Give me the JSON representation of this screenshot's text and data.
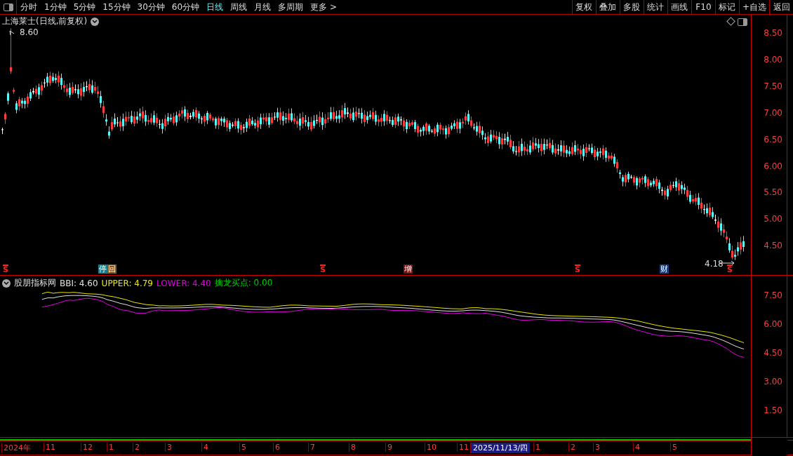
{
  "toolbar": {
    "periods": [
      {
        "label": "分时",
        "selected": false
      },
      {
        "label": "1分钟",
        "selected": false
      },
      {
        "label": "5分钟",
        "selected": false
      },
      {
        "label": "15分钟",
        "selected": false
      },
      {
        "label": "30分钟",
        "selected": false
      },
      {
        "label": "60分钟",
        "selected": false
      },
      {
        "label": "日线",
        "selected": true
      },
      {
        "label": "周线",
        "selected": false
      },
      {
        "label": "月线",
        "selected": false
      },
      {
        "label": "多周期",
        "selected": false
      },
      {
        "label": "更多 >",
        "selected": false
      }
    ],
    "actions": [
      "复权",
      "叠加",
      "多股",
      "统计",
      "画线",
      "F10",
      "标记",
      "+自选",
      "返回"
    ]
  },
  "price_panel": {
    "title": "上海莱士(日线,前复权)",
    "high_label": "8.60",
    "low_label": "4.18",
    "axis_labels": [
      "8.50",
      "8.00",
      "7.50",
      "7.00",
      "6.50",
      "6.00",
      "5.50",
      "5.00",
      "4.50"
    ],
    "markers": [
      {
        "kind": "signal",
        "text": "S"
      },
      {
        "kind": "tag",
        "text": "停",
        "color": "#167c86"
      },
      {
        "kind": "tag",
        "text": "回",
        "color": "#8a5418"
      },
      {
        "kind": "signal",
        "text": "S"
      },
      {
        "kind": "tag",
        "text": "增",
        "color": "#7a1010"
      },
      {
        "kind": "signal",
        "text": "S"
      },
      {
        "kind": "tag",
        "text": "财",
        "color": "#183f86"
      },
      {
        "kind": "signal",
        "text": "S"
      }
    ]
  },
  "indicator_panel": {
    "name": "股朋指标网",
    "readings": [
      {
        "text": "BBI: 4.60",
        "color": "#e0e0e0"
      },
      {
        "text": "UPPER: 4.79",
        "color": "#e8e800"
      },
      {
        "text": "LOWER: 4.40",
        "color": "#e000e0"
      },
      {
        "text": "擒龙买点: 0.00",
        "color": "#00d000"
      }
    ],
    "axis_labels": [
      "7.50",
      "6.00",
      "4.50",
      "3.00",
      "1.50"
    ]
  },
  "date_axis": [
    {
      "label": "2024年",
      "highlighted": false
    },
    {
      "label": "11",
      "highlighted": false
    },
    {
      "label": "12",
      "highlighted": false
    },
    {
      "label": "1",
      "highlighted": false
    },
    {
      "label": "2",
      "highlighted": false
    },
    {
      "label": "3",
      "highlighted": false
    },
    {
      "label": "4",
      "highlighted": false
    },
    {
      "label": "5",
      "highlighted": false
    },
    {
      "label": "6",
      "highlighted": false
    },
    {
      "label": "7",
      "highlighted": false
    },
    {
      "label": "8",
      "highlighted": false
    },
    {
      "label": "9",
      "highlighted": false
    },
    {
      "label": "10",
      "highlighted": false
    },
    {
      "label": "11",
      "highlighted": false
    },
    {
      "label": "2025/11/13/四",
      "highlighted": true
    },
    {
      "label": "1",
      "highlighted": false
    },
    {
      "label": "2",
      "highlighted": false
    },
    {
      "label": "3",
      "highlighted": false
    },
    {
      "label": "4",
      "highlighted": false
    },
    {
      "label": "5",
      "highlighted": false
    }
  ]
}
